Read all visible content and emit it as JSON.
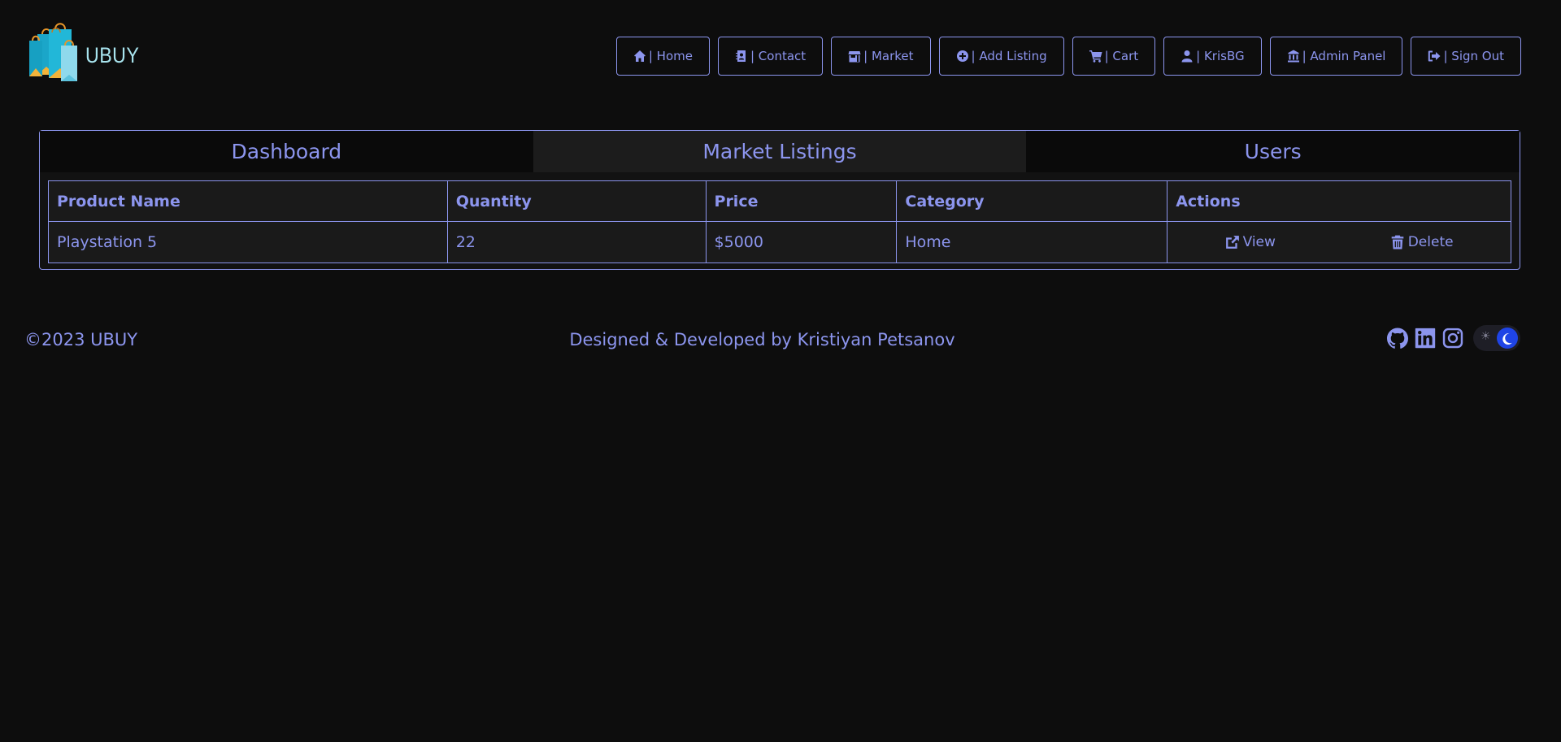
{
  "brand": {
    "name": "UBUY",
    "logo_icon": "shopping-bags-logo"
  },
  "nav": {
    "items": [
      {
        "icon": "home-icon",
        "label": "| Home"
      },
      {
        "icon": "contact-card-icon",
        "label": "| Contact"
      },
      {
        "icon": "store-icon",
        "label": "| Market"
      },
      {
        "icon": "plus-circle-icon",
        "label": "| Add Listing"
      },
      {
        "icon": "cart-icon",
        "label": "| Cart"
      },
      {
        "icon": "user-icon",
        "label": "| KrisBG"
      },
      {
        "icon": "bank-icon",
        "label": "| Admin Panel"
      },
      {
        "icon": "sign-out-icon",
        "label": "| Sign Out"
      }
    ]
  },
  "tabs": [
    {
      "label": "Dashboard",
      "active": false
    },
    {
      "label": "Market Listings",
      "active": true
    },
    {
      "label": "Users",
      "active": false
    }
  ],
  "table": {
    "headers": [
      "Product Name",
      "Quantity",
      "Price",
      "Category",
      "Actions"
    ],
    "rows": [
      {
        "product": "Playstation 5",
        "quantity": "22",
        "price": "$5000",
        "category": "Home",
        "view_label": "View",
        "delete_label": "Delete"
      }
    ]
  },
  "footer": {
    "copyright": "©2023 UBUY",
    "credit": "Designed & Developed by Kristiyan Petsanov",
    "theme_light_glyph": "☀",
    "socials": [
      "github-icon",
      "linkedin-icon",
      "instagram-icon"
    ]
  },
  "colors": {
    "accent": "#8c95ee",
    "background": "#0d0d0d",
    "toggle_knob": "#1f44e6",
    "logo_text": "#a8e4ee"
  }
}
